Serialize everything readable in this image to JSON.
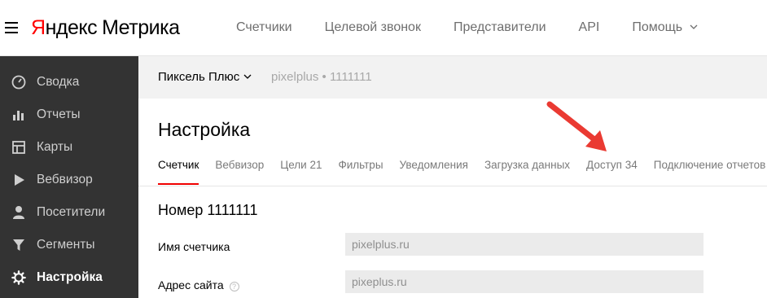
{
  "header": {
    "logo_brand_first": "Я",
    "logo_brand_rest": "ндекс",
    "logo_product": "Метрика",
    "nav": [
      {
        "label": "Счетчики"
      },
      {
        "label": "Целевой звонок"
      },
      {
        "label": "Представители"
      },
      {
        "label": "API"
      },
      {
        "label": "Помощь"
      }
    ]
  },
  "sidebar": {
    "items": [
      {
        "label": "Сводка",
        "icon": "gauge-icon"
      },
      {
        "label": "Отчеты",
        "icon": "bar-chart-icon"
      },
      {
        "label": "Карты",
        "icon": "map-icon"
      },
      {
        "label": "Вебвизор",
        "icon": "play-icon"
      },
      {
        "label": "Посетители",
        "icon": "user-icon"
      },
      {
        "label": "Сегменты",
        "icon": "funnel-icon"
      },
      {
        "label": "Настройка",
        "icon": "gear-icon",
        "active": true
      }
    ]
  },
  "counter": {
    "name": "Пиксель Плюс",
    "info": "pixelplus • 1111111"
  },
  "page": {
    "title": "Настройка",
    "tabs": [
      {
        "label": "Счетчик",
        "active": true
      },
      {
        "label": "Вебвизор"
      },
      {
        "label": "Цели 21"
      },
      {
        "label": "Фильтры"
      },
      {
        "label": "Уведомления"
      },
      {
        "label": "Загрузка данных"
      },
      {
        "label": "Доступ 34"
      },
      {
        "label": "Подключение отчетов"
      }
    ],
    "section_title": "Номер 1111111",
    "fields": [
      {
        "label": "Имя счетчика",
        "value": "pixelplus.ru"
      },
      {
        "label": "Адрес сайта",
        "value": "pixeplus.ru"
      }
    ],
    "help_glyph": "?"
  },
  "colors": {
    "brand_red": "#ff0000",
    "sidebar_bg": "#333333",
    "active_tab_underline": "#f00000",
    "annotation_arrow": "#ea3a32"
  }
}
